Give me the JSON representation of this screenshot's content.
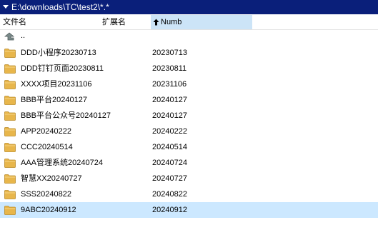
{
  "path_bar": {
    "path": "E:\\downloads\\TC\\test2\\*.*"
  },
  "columns": {
    "name": "文件名",
    "extension": "扩展名",
    "numb": "Numb"
  },
  "parent_dir": {
    "label": ".."
  },
  "rows": [
    {
      "name": "DDD小程序20230713",
      "numb": "20230713"
    },
    {
      "name": "DDD钉钉页面20230811",
      "numb": "20230811"
    },
    {
      "name": "XXXX项目20231106",
      "numb": "20231106"
    },
    {
      "name": "BBB平台20240127",
      "numb": "20240127"
    },
    {
      "name": "BBB平台公众号20240127",
      "numb": "20240127"
    },
    {
      "name": "APP20240222",
      "numb": "20240222"
    },
    {
      "name": "CCC20240514",
      "numb": "20240514"
    },
    {
      "name": "AAA管理系统20240724",
      "numb": "20240724"
    },
    {
      "name": "智慧XX20240727",
      "numb": "20240727"
    },
    {
      "name": "SSS20240822",
      "numb": "20240822"
    },
    {
      "name": "9ABC20240912",
      "numb": "20240912"
    }
  ],
  "selected_row_index": 10,
  "icons": {
    "dropdown": "chevron-down-icon",
    "sort": "sort-ascending-arrow-icon",
    "parent": "parent-directory-icon",
    "folder": "folder-icon"
  },
  "colors": {
    "path_bar_bg": "#0a1f7a",
    "sorted_column_bg": "#cce4f7",
    "selection_bg": "#cce8ff",
    "folder": "#e8b64b"
  }
}
